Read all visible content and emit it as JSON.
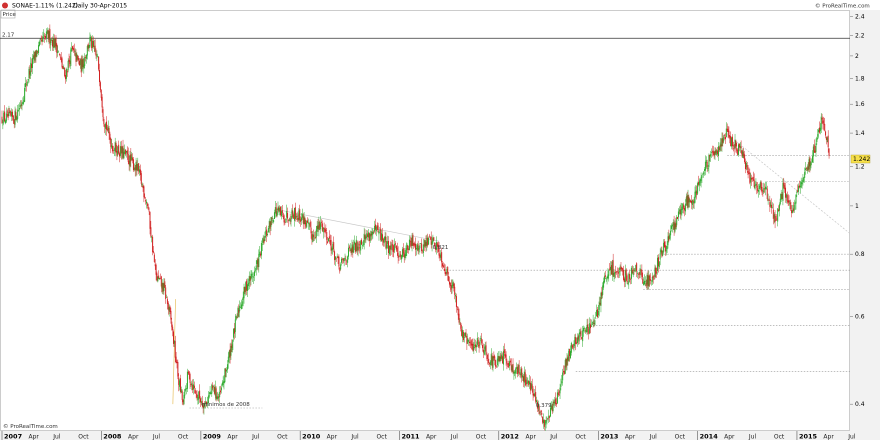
{
  "header": {
    "symbol": "SONAE",
    "change": "-1.11% (1.242)",
    "period": "Daily",
    "date": "30-Apr-2015",
    "watermark": "© ProRealTime.com"
  },
  "panel": {
    "tab_label": "Price",
    "first_level_label": "2.17",
    "footer": "© ProRealTime.com"
  },
  "colors": {
    "up": "#2eaa2e",
    "down": "#d02020",
    "axis_fill": "#f2f2f2",
    "grid": "#bbbbbb",
    "trend": "#c8c8c8",
    "price_badge": "#f7e04a"
  },
  "chart_data": {
    "type": "candlestick",
    "title": "SONAE",
    "yaxis": {
      "scale": "log",
      "ylim": [
        0.355,
        2.45
      ],
      "ticks": [
        0.4,
        0.6,
        0.8,
        1,
        1.2,
        1.4,
        1.6,
        1.8,
        2,
        2.2,
        2.4
      ]
    },
    "xaxis": {
      "range": [
        "2007-01-01",
        "2015-07-15"
      ],
      "ticks": [
        {
          "date": "2007-01-01",
          "label": "2007",
          "major": true
        },
        {
          "date": "2007-04-01",
          "label": "Apr"
        },
        {
          "date": "2007-07-01",
          "label": "Jul"
        },
        {
          "date": "2007-10-01",
          "label": "Oct"
        },
        {
          "date": "2008-01-01",
          "label": "2008",
          "major": true
        },
        {
          "date": "2008-04-01",
          "label": "Apr"
        },
        {
          "date": "2008-07-01",
          "label": "Jul"
        },
        {
          "date": "2008-10-01",
          "label": "Oct"
        },
        {
          "date": "2009-01-01",
          "label": "2009",
          "major": true
        },
        {
          "date": "2009-04-01",
          "label": "Apr"
        },
        {
          "date": "2009-07-01",
          "label": "Jul"
        },
        {
          "date": "2009-10-01",
          "label": "Oct"
        },
        {
          "date": "2010-01-01",
          "label": "2010",
          "major": true
        },
        {
          "date": "2010-04-01",
          "label": "Apr"
        },
        {
          "date": "2010-07-01",
          "label": "Jul"
        },
        {
          "date": "2010-10-01",
          "label": "Oct"
        },
        {
          "date": "2011-01-01",
          "label": "2011",
          "major": true
        },
        {
          "date": "2011-04-01",
          "label": "Apr"
        },
        {
          "date": "2011-07-01",
          "label": "Jul"
        },
        {
          "date": "2011-10-01",
          "label": "Oct"
        },
        {
          "date": "2012-01-01",
          "label": "2012",
          "major": true
        },
        {
          "date": "2012-04-01",
          "label": "Apr"
        },
        {
          "date": "2012-07-01",
          "label": "Jul"
        },
        {
          "date": "2012-10-01",
          "label": "Oct"
        },
        {
          "date": "2013-01-01",
          "label": "2013",
          "major": true
        },
        {
          "date": "2013-04-01",
          "label": "Apr"
        },
        {
          "date": "2013-07-01",
          "label": "Jul"
        },
        {
          "date": "2013-10-01",
          "label": "Oct"
        },
        {
          "date": "2014-01-01",
          "label": "2014",
          "major": true
        },
        {
          "date": "2014-04-01",
          "label": "Apr"
        },
        {
          "date": "2014-07-01",
          "label": "Jul"
        },
        {
          "date": "2014-10-01",
          "label": "Oct"
        },
        {
          "date": "2015-01-01",
          "label": "2015",
          "major": true
        },
        {
          "date": "2015-04-01",
          "label": "Apr"
        },
        {
          "date": "2015-07-01",
          "label": "Jul"
        }
      ]
    },
    "price_path": [
      [
        "2007-01-01",
        1.5
      ],
      [
        "2007-02-15",
        1.5
      ],
      [
        "2007-03-15",
        1.62
      ],
      [
        "2007-04-10",
        1.85
      ],
      [
        "2007-05-10",
        2.05
      ],
      [
        "2007-06-01",
        2.15
      ],
      [
        "2007-06-20",
        2.2
      ],
      [
        "2007-07-20",
        2.1
      ],
      [
        "2007-08-20",
        1.82
      ],
      [
        "2007-09-15",
        2.05
      ],
      [
        "2007-10-20",
        1.9
      ],
      [
        "2007-11-20",
        2.15
      ],
      [
        "2007-12-20",
        1.95
      ],
      [
        "2008-01-10",
        1.5
      ],
      [
        "2008-02-10",
        1.32
      ],
      [
        "2008-04-01",
        1.26
      ],
      [
        "2008-05-15",
        1.18
      ],
      [
        "2008-06-20",
        1.0
      ],
      [
        "2008-07-20",
        0.72
      ],
      [
        "2008-08-20",
        0.68
      ],
      [
        "2008-09-15",
        0.58
      ],
      [
        "2008-10-10",
        0.45
      ],
      [
        "2008-10-28",
        0.4
      ],
      [
        "2008-11-15",
        0.46
      ],
      [
        "2008-12-15",
        0.42
      ],
      [
        "2009-01-15",
        0.4
      ],
      [
        "2009-02-15",
        0.43
      ],
      [
        "2009-03-10",
        0.41
      ],
      [
        "2009-04-15",
        0.5
      ],
      [
        "2009-05-20",
        0.62
      ],
      [
        "2009-06-20",
        0.7
      ],
      [
        "2009-07-20",
        0.74
      ],
      [
        "2009-08-20",
        0.85
      ],
      [
        "2009-10-01",
        0.98
      ],
      [
        "2009-11-01",
        0.95
      ],
      [
        "2009-12-10",
        0.97
      ],
      [
        "2010-01-15",
        0.94
      ],
      [
        "2010-02-15",
        0.87
      ],
      [
        "2010-03-20",
        0.92
      ],
      [
        "2010-04-20",
        0.85
      ],
      [
        "2010-05-25",
        0.75
      ],
      [
        "2010-06-25",
        0.8
      ],
      [
        "2010-07-25",
        0.83
      ],
      [
        "2010-09-01",
        0.87
      ],
      [
        "2010-10-10",
        0.89
      ],
      [
        "2010-11-20",
        0.83
      ],
      [
        "2011-01-10",
        0.8
      ],
      [
        "2011-02-20",
        0.85
      ],
      [
        "2011-03-20",
        0.82
      ],
      [
        "2011-04-25",
        0.86
      ],
      [
        "2011-05-25",
        0.82
      ],
      [
        "2011-06-20",
        0.74
      ],
      [
        "2011-07-20",
        0.68
      ],
      [
        "2011-08-20",
        0.55
      ],
      [
        "2011-09-25",
        0.52
      ],
      [
        "2011-10-25",
        0.54
      ],
      [
        "2011-11-20",
        0.5
      ],
      [
        "2011-12-20",
        0.48
      ],
      [
        "2012-01-25",
        0.5
      ],
      [
        "2012-02-25",
        0.47
      ],
      [
        "2012-03-25",
        0.46
      ],
      [
        "2012-04-25",
        0.44
      ],
      [
        "2012-05-25",
        0.39
      ],
      [
        "2012-06-15",
        0.365
      ],
      [
        "2012-07-10",
        0.39
      ],
      [
        "2012-08-10",
        0.42
      ],
      [
        "2012-09-10",
        0.5
      ],
      [
        "2012-10-10",
        0.54
      ],
      [
        "2012-11-10",
        0.56
      ],
      [
        "2012-12-20",
        0.58
      ],
      [
        "2013-01-20",
        0.7
      ],
      [
        "2013-02-20",
        0.75
      ],
      [
        "2013-03-20",
        0.73
      ],
      [
        "2013-04-20",
        0.72
      ],
      [
        "2013-05-20",
        0.76
      ],
      [
        "2013-06-20",
        0.7
      ],
      [
        "2013-07-20",
        0.72
      ],
      [
        "2013-08-20",
        0.8
      ],
      [
        "2013-09-20",
        0.87
      ],
      [
        "2013-10-20",
        0.95
      ],
      [
        "2013-11-20",
        1.02
      ],
      [
        "2013-12-20",
        1.05
      ],
      [
        "2014-01-20",
        1.17
      ],
      [
        "2014-02-20",
        1.25
      ],
      [
        "2014-03-20",
        1.32
      ],
      [
        "2014-04-15",
        1.4
      ],
      [
        "2014-05-10",
        1.33
      ],
      [
        "2014-06-10",
        1.28
      ],
      [
        "2014-07-10",
        1.15
      ],
      [
        "2014-08-10",
        1.1
      ],
      [
        "2014-09-10",
        1.07
      ],
      [
        "2014-10-15",
        0.93
      ],
      [
        "2014-11-10",
        1.08
      ],
      [
        "2014-12-15",
        0.98
      ],
      [
        "2015-01-15",
        1.1
      ],
      [
        "2015-02-10",
        1.2
      ],
      [
        "2015-03-10",
        1.32
      ],
      [
        "2015-04-01",
        1.48
      ],
      [
        "2015-04-15",
        1.44
      ],
      [
        "2015-04-30",
        1.242
      ]
    ],
    "horizontal_levels": [
      {
        "value": 2.17,
        "style": "solid",
        "label": "2.17"
      },
      {
        "value": 1.262,
        "style": "dotted",
        "from": "2014-04-20"
      },
      {
        "value": 1.12,
        "style": "dotted",
        "from": "2014-09-10"
      },
      {
        "value": 0.8,
        "style": "dotted",
        "from": "2013-08-20"
      },
      {
        "value": 0.743,
        "style": "dotted",
        "from": "2011-06-01"
      },
      {
        "value": 0.68,
        "style": "dotted",
        "from": "2013-06-15"
      },
      {
        "value": 0.575,
        "style": "dotted",
        "from": "2012-11-20"
      },
      {
        "value": 0.465,
        "style": "dotted",
        "from": "2012-10-10"
      },
      {
        "value": 0.393,
        "style": "dotted",
        "from": "2008-11-20",
        "to": "2009-08-15",
        "label": "mínimos de 2008"
      }
    ],
    "trendlines": [
      {
        "from": [
          "2009-10-01",
          0.985
        ],
        "to": [
          "2011-05-25",
          0.85
        ],
        "label": "0.821"
      },
      {
        "from": [
          "2014-04-15",
          1.4
        ],
        "to": [
          "2015-07-15",
          0.88
        ]
      },
      {
        "from": [
          "2008-09-20",
          0.4
        ],
        "to": [
          "2008-09-30",
          0.65
        ]
      }
    ],
    "annotations": [
      {
        "date": "2012-06-15",
        "value": 0.4,
        "text": "0.379"
      }
    ],
    "last_price": {
      "value": 1.242,
      "label": "1.242"
    }
  }
}
